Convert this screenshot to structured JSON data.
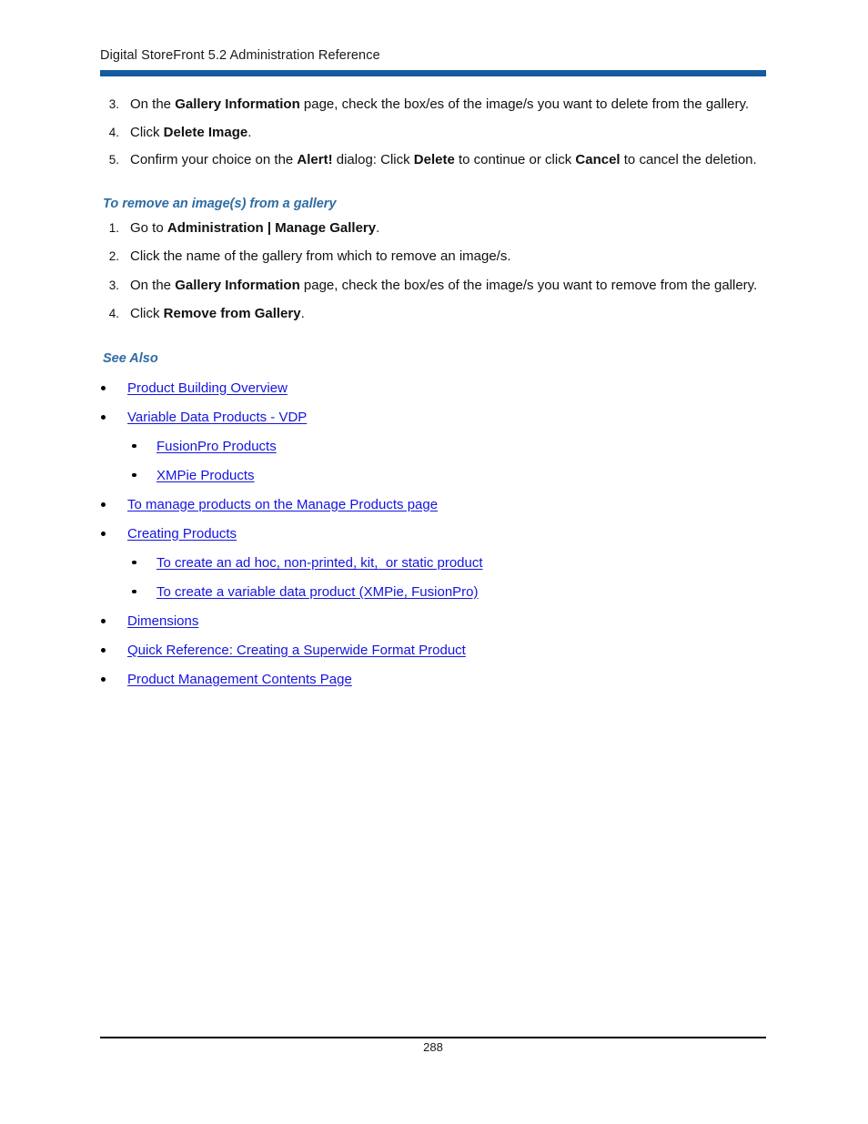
{
  "document": {
    "header_title": "Digital StoreFront 5.2 Administration Reference",
    "page_number": "288",
    "accent_bar_color": "#155B9E",
    "heading_color": "#2E6CA4",
    "link_color": "#1414E0"
  },
  "delete_steps": [
    {
      "number": "3.",
      "parts": [
        {
          "text": "On the ",
          "bold": false
        },
        {
          "text": "Gallery Information",
          "bold": true
        },
        {
          "text": " page, check the box/es of the image/s you want to delete from the gallery.",
          "bold": false
        }
      ]
    },
    {
      "number": "4.",
      "parts": [
        {
          "text": "Click ",
          "bold": false
        },
        {
          "text": "Delete Image",
          "bold": true
        },
        {
          "text": ".",
          "bold": false
        }
      ]
    },
    {
      "number": "5.",
      "parts": [
        {
          "text": "Confirm your choice on the ",
          "bold": false
        },
        {
          "text": "Alert!",
          "bold": true
        },
        {
          "text": " dialog: Click ",
          "bold": false
        },
        {
          "text": "Delete",
          "bold": true
        },
        {
          "text": " to continue or click ",
          "bold": false
        },
        {
          "text": "Cancel",
          "bold": true
        },
        {
          "text": " to cancel the deletion.",
          "bold": false
        }
      ]
    }
  ],
  "remove_section": {
    "heading": "To remove an image(s) from a gallery",
    "steps": [
      {
        "number": "1.",
        "parts": [
          {
            "text": "Go to ",
            "bold": false
          },
          {
            "text": "Administration | Manage Gallery",
            "bold": true
          },
          {
            "text": ".",
            "bold": false
          }
        ]
      },
      {
        "number": "2.",
        "parts": [
          {
            "text": "Click the name of the gallery from which to remove an image/s.",
            "bold": false
          }
        ]
      },
      {
        "number": "3.",
        "parts": [
          {
            "text": "On the ",
            "bold": false
          },
          {
            "text": "Gallery Information",
            "bold": true
          },
          {
            "text": " page, check the box/es of the image/s you want to remove from the gallery.",
            "bold": false
          }
        ]
      },
      {
        "number": "4.",
        "parts": [
          {
            "text": "Click ",
            "bold": false
          },
          {
            "text": "Remove from Gallery",
            "bold": true
          },
          {
            "text": ".",
            "bold": false
          }
        ]
      }
    ]
  },
  "see_also": {
    "heading": "See Also",
    "links": [
      {
        "label": "Product Building Overview",
        "level": 1
      },
      {
        "label": "Variable Data Products - VDP",
        "level": 1
      },
      {
        "label": "FusionPro Products",
        "level": 2
      },
      {
        "label": "XMPie Products",
        "level": 2
      },
      {
        "label": "To manage products on the Manage Products page",
        "level": 1
      },
      {
        "label": "Creating Products",
        "level": 1
      },
      {
        "label": "To create an ad hoc, non-printed, kit,  or static product",
        "level": 2
      },
      {
        "label": "To create a variable data product (XMPie, FusionPro)",
        "level": 2
      },
      {
        "label": "Dimensions",
        "level": 1
      },
      {
        "label": "Quick Reference: Creating a Superwide Format Product",
        "level": 1
      },
      {
        "label": "Product Management Contents Page",
        "level": 1
      }
    ]
  }
}
